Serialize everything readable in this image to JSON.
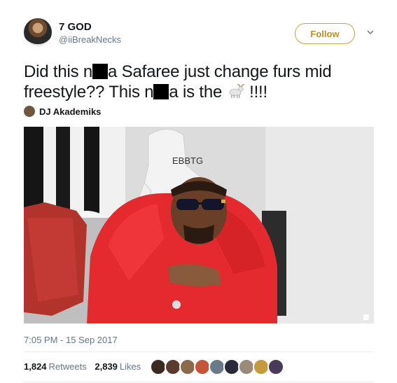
{
  "author": {
    "display_name": "7 GOD",
    "handle": "@iiBreakNecks"
  },
  "actions": {
    "follow_label": "Follow"
  },
  "tweet": {
    "part1": "Did this n",
    "part2": "a Safaree just change furs mid freestyle?? This n",
    "part3": "a is the ",
    "part4": " !!!!"
  },
  "quoted_account": {
    "name": "DJ Akademiks"
  },
  "media": {
    "shirt_text": "EBBTG"
  },
  "meta": {
    "timestamp": "7:05 PM - 15 Sep 2017"
  },
  "stats": {
    "retweets_count": "1,824",
    "retweets_label": "Retweets",
    "likes_count": "2,839",
    "likes_label": "Likes"
  },
  "likers": [
    {
      "color": "#3a2a22"
    },
    {
      "color": "#5b3b2b"
    },
    {
      "color": "#8a6a4a"
    },
    {
      "color": "#c4553a"
    },
    {
      "color": "#6a7a8a"
    },
    {
      "color": "#2a2a3a"
    },
    {
      "color": "#9a8a7a"
    },
    {
      "color": "#c59a3a"
    },
    {
      "color": "#4a3a5a"
    }
  ]
}
